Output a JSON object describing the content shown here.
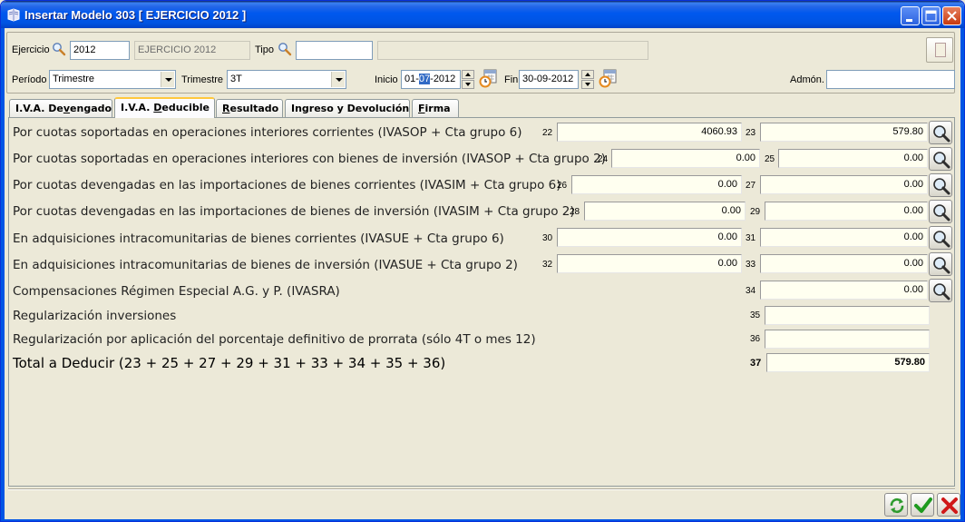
{
  "window": {
    "title": "Insertar Modelo 303 [ EJERCICIO 2012 ]"
  },
  "header": {
    "ejercicio_label": "Ejercicio",
    "ejercicio_value": "2012",
    "ejercicio_desc": "EJERCICIO 2012",
    "tipo_label": "Tipo",
    "tipo_value": "",
    "tipo_desc": "",
    "periodo_label": "Período",
    "periodo_value": "Trimestre",
    "trimestre_label": "Trimestre",
    "trimestre_value": "3T",
    "inicio_label": "Inicio",
    "inicio_day": "01-",
    "inicio_month": "07",
    "inicio_year": "-2012",
    "fin_label": "Fin",
    "fin_value": "30-09-2012",
    "admon_label": "Admón.",
    "admon_value": ""
  },
  "tabs": [
    {
      "label_pre": "I.V.A. De",
      "label_u": "v",
      "label_post": "engado"
    },
    {
      "label_pre": "I.V.A. ",
      "label_u": "D",
      "label_post": "educible"
    },
    {
      "label_pre": "",
      "label_u": "R",
      "label_post": "esultado"
    },
    {
      "label_pre": "Ingreso y Devolución",
      "label_u": "",
      "label_post": ""
    },
    {
      "label_pre": "",
      "label_u": "F",
      "label_post": "irma"
    }
  ],
  "rows": [
    {
      "label": "Por cuotas soportadas en operaciones interiores corrientes (IVASOP + Cta grupo 6)",
      "c1": "22",
      "v1": "4060.93",
      "c2": "23",
      "v2": "579.80"
    },
    {
      "label": "Por cuotas soportadas en operaciones interiores con bienes de inversión  (IVASOP + Cta grupo 2)",
      "c1": "24",
      "v1": "0.00",
      "c2": "25",
      "v2": "0.00"
    },
    {
      "label": "Por cuotas devengadas en las importaciones de bienes corrientes  (IVASIM + Cta grupo 6)",
      "c1": "26",
      "v1": "0.00",
      "c2": "27",
      "v2": "0.00"
    },
    {
      "label": "Por cuotas devengadas en las importaciones de bienes de inversión  (IVASIM + Cta grupo 2)",
      "c1": "28",
      "v1": "0.00",
      "c2": "29",
      "v2": "0.00"
    },
    {
      "label": "En adquisiciones intracomunitarias de bienes corrientes  (IVASUE + Cta grupo 6)",
      "c1": "30",
      "v1": "0.00",
      "c2": "31",
      "v2": "0.00"
    },
    {
      "label": "En adquisiciones intracomunitarias de bienes de inversión  (IVASUE + Cta grupo 2)",
      "c1": "32",
      "v1": "0.00",
      "c2": "33",
      "v2": "0.00"
    },
    {
      "label": "Compensaciones Régimen Especial A.G. y P.  (IVASRA)",
      "c2": "34",
      "v2": "0.00"
    },
    {
      "label": "Regularización inversiones",
      "c2": "35",
      "v2": ""
    },
    {
      "label": "Regularización por aplicación del porcentaje definitivo de prorrata (sólo 4T o mes 12)",
      "c2": "36",
      "v2": ""
    },
    {
      "label": "Total a Deducir (23 + 25 + 27 + 29 + 31 + 33 + 34 + 35 + 36)",
      "c2": "37",
      "v2": "579.80"
    }
  ],
  "colors": {
    "title_bar": "#0054E3",
    "window_bg": "#ECE9D8",
    "field_bg": "#FFFFF0",
    "active_tab_accent": "#FFC83C"
  },
  "icons": {
    "search": "magnifier-icon",
    "calendar": "calendar-icon",
    "refresh": "refresh-icon",
    "accept": "check-icon",
    "cancel": "close-icon"
  }
}
